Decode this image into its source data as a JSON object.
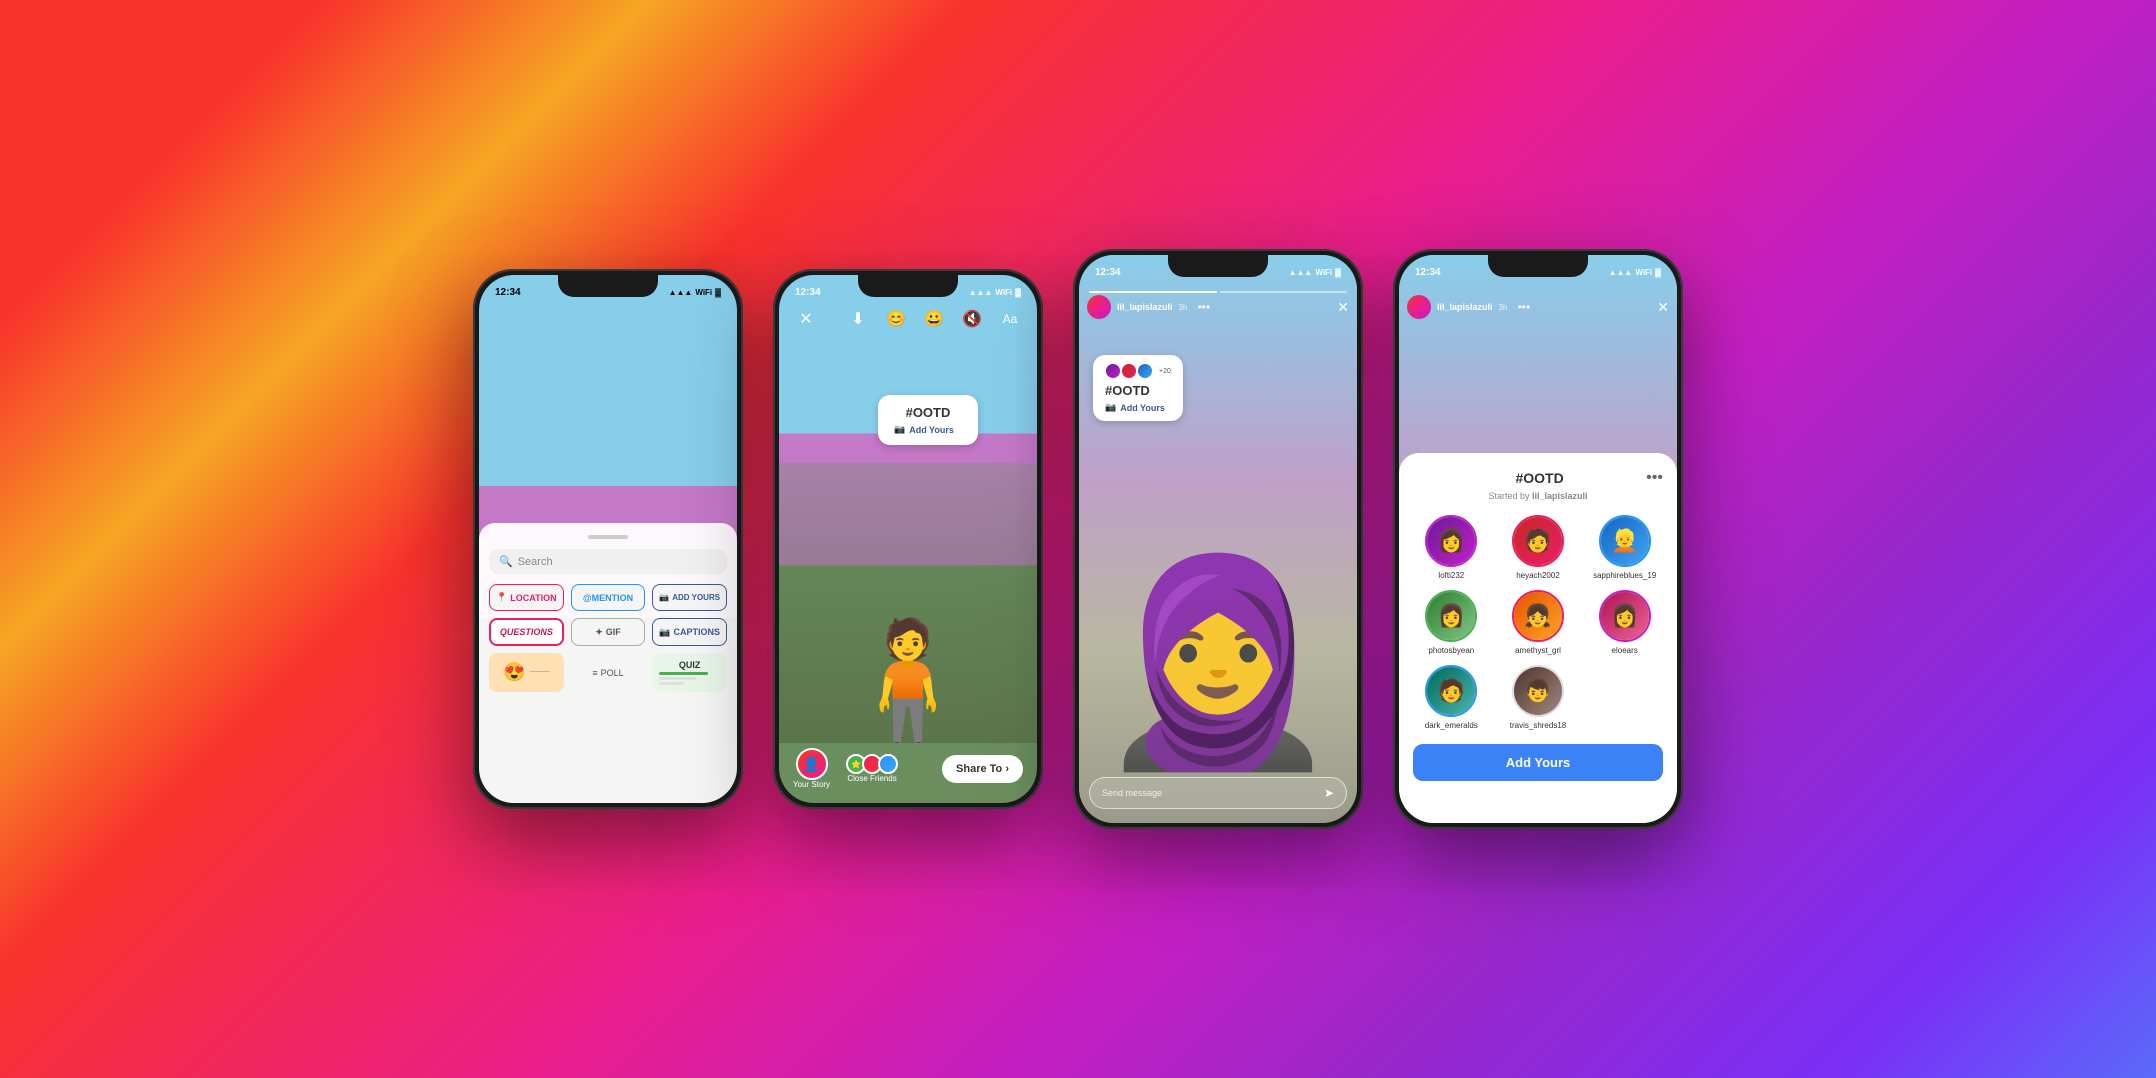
{
  "background": {
    "gradient": "instagram-gradient"
  },
  "phones": [
    {
      "id": "phone1",
      "name": "Sticker Tray",
      "status_time": "12:34",
      "sticker_tray": {
        "search_placeholder": "Search",
        "stickers": [
          {
            "label": "LOCATION",
            "type": "location",
            "icon": "📍"
          },
          {
            "label": "@MENTION",
            "type": "mention",
            "icon": "@"
          },
          {
            "label": "ADD YOURS",
            "type": "addyours",
            "icon": "📷"
          },
          {
            "label": "QUESTIONS",
            "type": "questions",
            "icon": ""
          },
          {
            "label": "GIF",
            "type": "gif",
            "icon": "GIF"
          },
          {
            "label": "CAPTIONS",
            "type": "captions",
            "icon": "📷"
          }
        ],
        "bottom_stickers": [
          {
            "label": "😍",
            "type": "emoji"
          },
          {
            "label": "POLL",
            "type": "poll"
          },
          {
            "label": "QUIZ",
            "type": "quiz"
          }
        ]
      }
    },
    {
      "id": "phone2",
      "name": "Story Editor",
      "status_time": "12:34",
      "ootd_sticker": {
        "title": "#OOTD",
        "add_yours_label": "Add Yours"
      },
      "share_bar": {
        "your_story_label": "Your Story",
        "close_friends_label": "Close Friends",
        "share_to_label": "Share To ›"
      }
    },
    {
      "id": "phone3",
      "name": "Story View",
      "status_time": "12:34",
      "story_user": {
        "username": "lil_lapislazuli",
        "time_ago": "3h"
      },
      "ootd_sticker": {
        "title": "#OOTD",
        "plus_count": "+20",
        "add_yours_label": "Add Yours"
      },
      "message_placeholder": "Send message"
    },
    {
      "id": "phone4",
      "name": "Add Yours Sheet",
      "status_time": "12:34",
      "story_user": {
        "username": "lil_lapislazuli",
        "time_ago": "3h"
      },
      "sheet": {
        "title": "#OOTD",
        "subtitle_prefix": "Started by",
        "subtitle_user": "lil_lapislazuli",
        "participants": [
          {
            "name": "lofti232",
            "color": "av-purple",
            "ring": "ring-purple"
          },
          {
            "name": "heyach2002",
            "color": "av-red",
            "ring": "ring-red"
          },
          {
            "name": "sapphireblues_19",
            "color": "av-blue",
            "ring": "ring-blue"
          },
          {
            "name": "photosbyean",
            "color": "av-green",
            "ring": "ring-green"
          },
          {
            "name": "amethyst_grl",
            "color": "av-orange",
            "ring": "ring-red"
          },
          {
            "name": "eloears",
            "color": "av-pink",
            "ring": "ring-purple"
          },
          {
            "name": "dark_emeralds",
            "color": "av-teal",
            "ring": "ring-blue"
          },
          {
            "name": "travis_shreds18",
            "color": "av-brown",
            "ring": "ring-orange"
          }
        ],
        "cta_label": "Add Yours"
      }
    }
  ]
}
